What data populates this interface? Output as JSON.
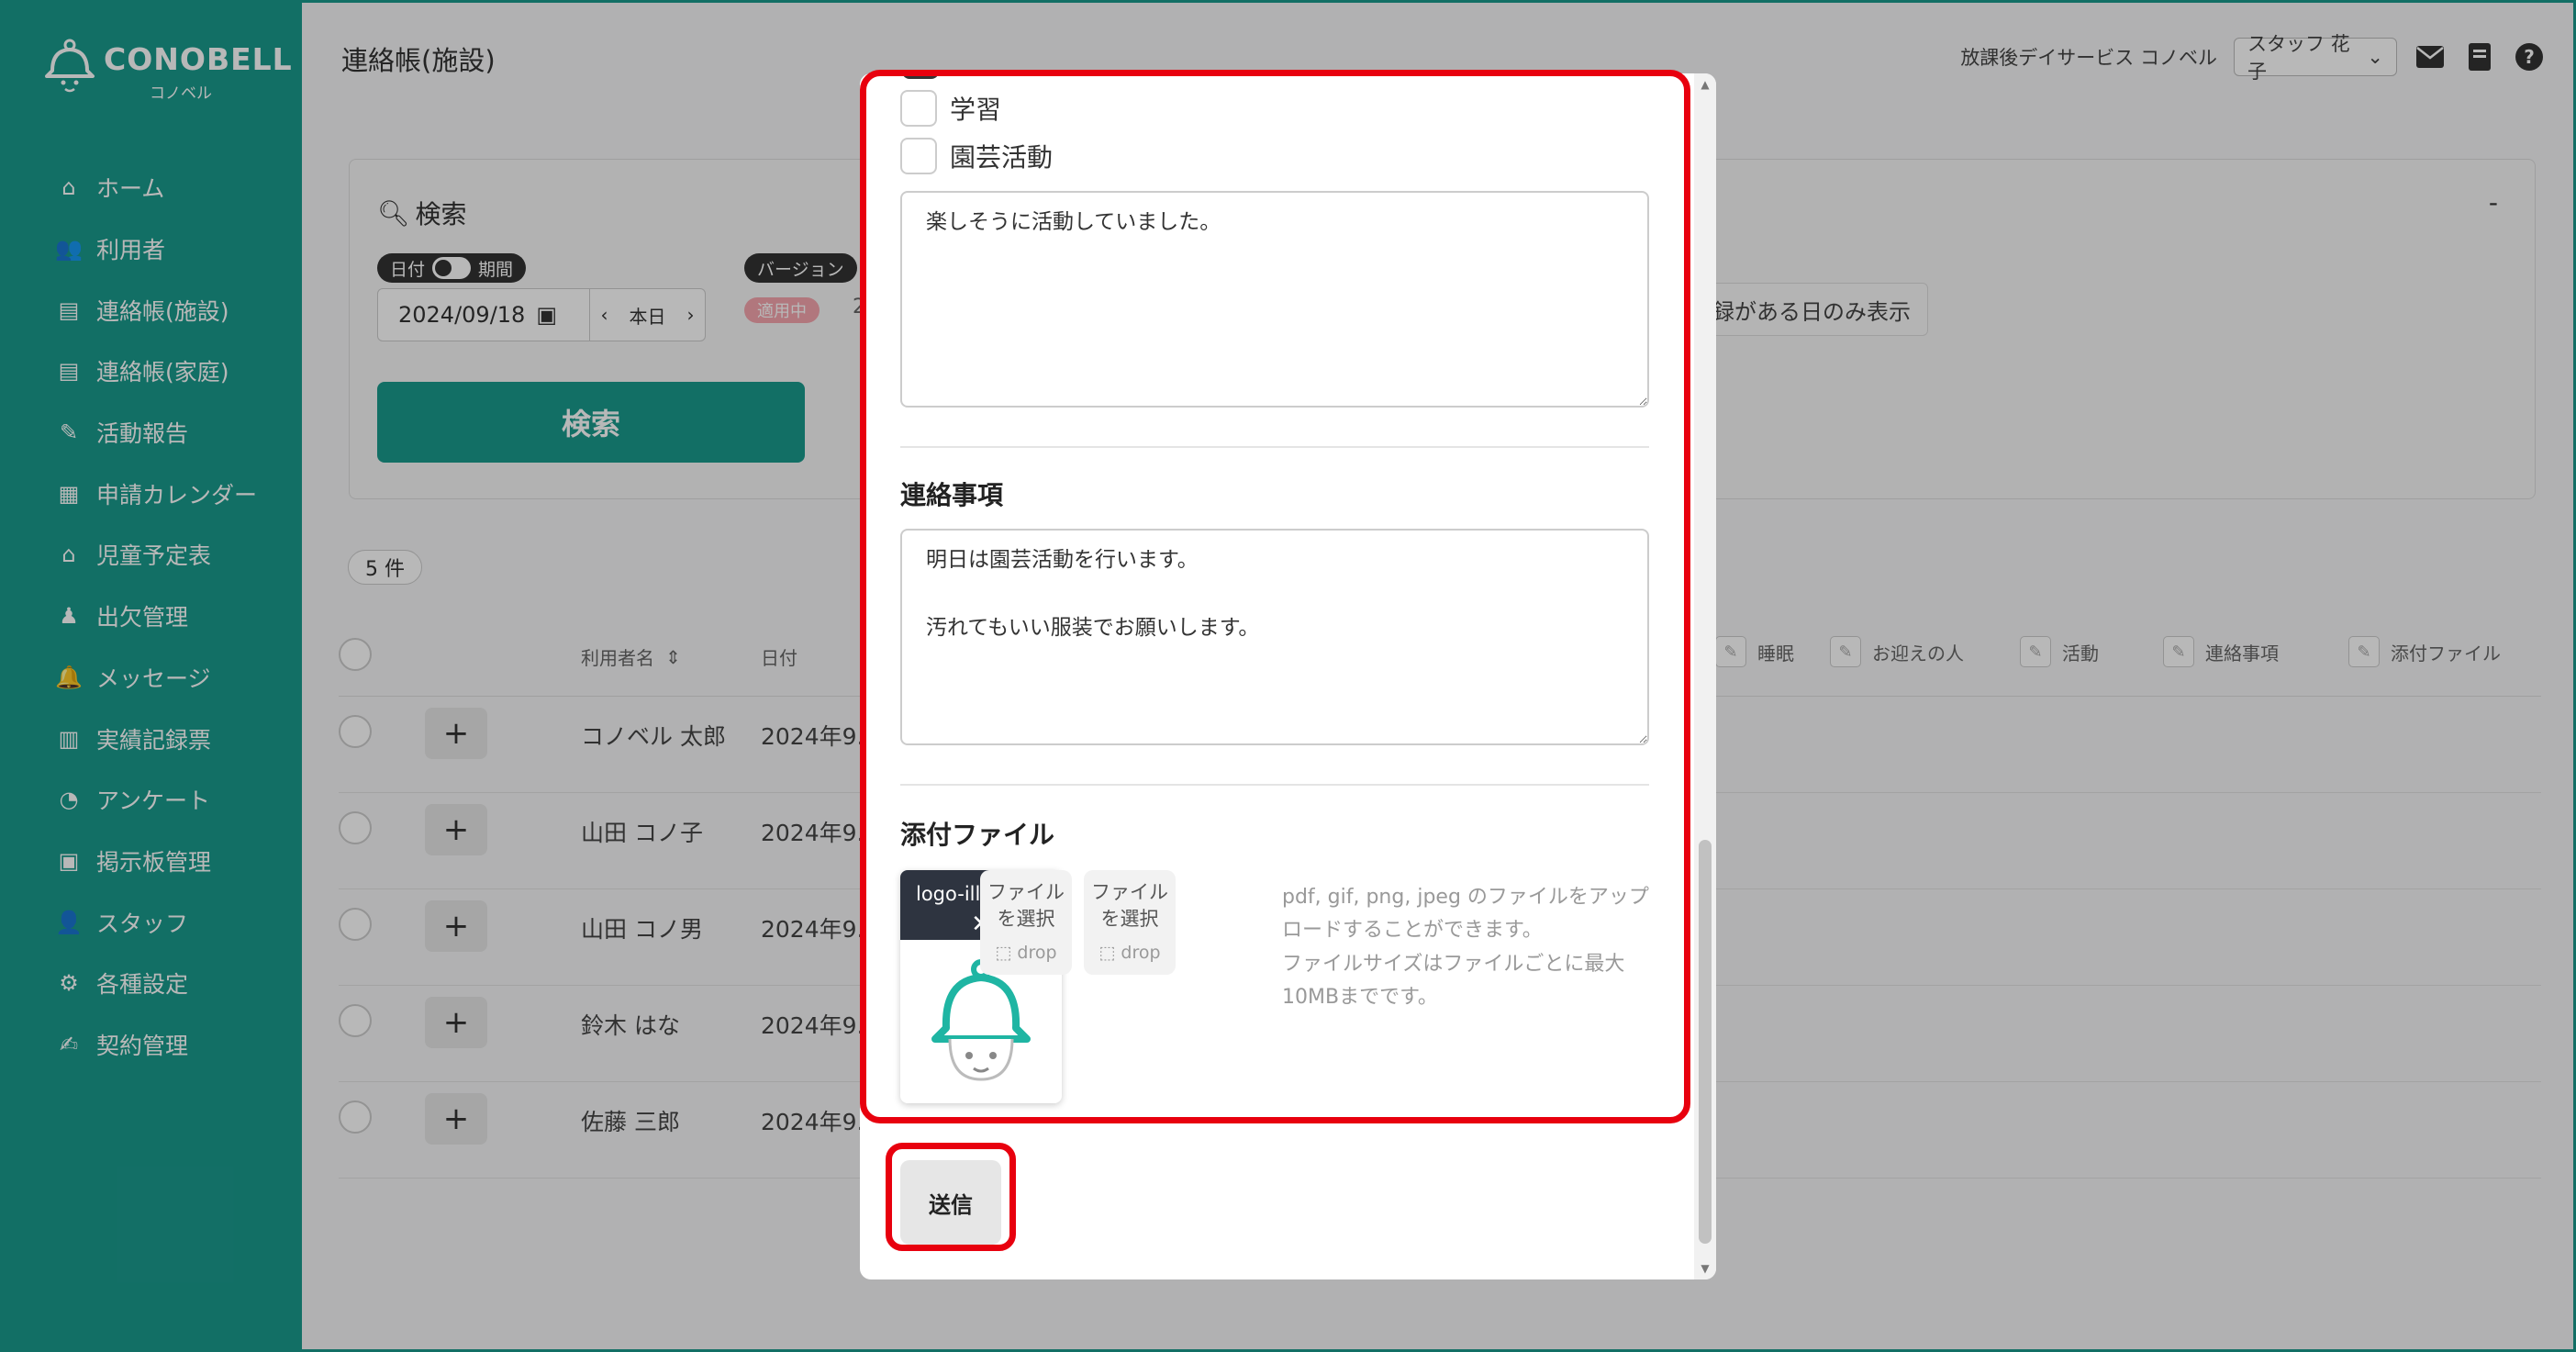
{
  "app": {
    "logo_name": "CONOBELL",
    "logo_kana": "コノベル",
    "page_title": "連絡帳(施設)",
    "facility": "放課後デイサービス コノベル",
    "staff": "スタッフ 花子"
  },
  "sidebar": {
    "items": [
      {
        "label": "ホーム",
        "icon": "home-icon"
      },
      {
        "label": "利用者",
        "icon": "users-icon"
      },
      {
        "label": "連絡帳(施設)",
        "icon": "notebook-icon"
      },
      {
        "label": "連絡帳(家庭)",
        "icon": "notebook-icon"
      },
      {
        "label": "活動報告",
        "icon": "report-edit-icon"
      },
      {
        "label": "申請カレンダー",
        "icon": "calendar-icon"
      },
      {
        "label": "児童予定表",
        "icon": "schedule-icon"
      },
      {
        "label": "出欠管理",
        "icon": "attendance-icon"
      },
      {
        "label": "メッセージ",
        "icon": "bell-icon"
      },
      {
        "label": "実績記録票",
        "icon": "table-icon"
      },
      {
        "label": "アンケート",
        "icon": "pie-chart-icon"
      },
      {
        "label": "掲示板管理",
        "icon": "board-icon"
      },
      {
        "label": "スタッフ",
        "icon": "staff-icon"
      },
      {
        "label": "各種設定",
        "icon": "gear-icon"
      },
      {
        "label": "契約管理",
        "icon": "contract-icon"
      }
    ]
  },
  "search": {
    "title": "検索",
    "collapse": "-",
    "date_pill": "日付",
    "period_pill": "期間",
    "date_value": "2024/09/18",
    "today": "本日",
    "version_pill": "バージョン",
    "applied_badge": "適用中",
    "applied_badge_extra": "2",
    "filter_label": "録がある日のみ表示",
    "button": "検索"
  },
  "list": {
    "count": "5 件",
    "headers": {
      "name": "利用者名",
      "date": "日付"
    },
    "columns": [
      "睡眠",
      "お迎えの人",
      "活動",
      "連絡事項",
      "添付ファイル"
    ],
    "rows": [
      {
        "name": "コノベル 太郎",
        "date": "2024年9."
      },
      {
        "name": "山田 コノ子",
        "date": "2024年9."
      },
      {
        "name": "山田 コノ男",
        "date": "2024年9."
      },
      {
        "name": "鈴木 はな",
        "date": "2024年9."
      },
      {
        "name": "佐藤 三郎",
        "date": "2024年9."
      }
    ]
  },
  "modal": {
    "activities": [
      "学習",
      "園芸活動"
    ],
    "activity_note": "楽しそうに活動していました。",
    "contact_label": "連絡事項",
    "contact_text": "明日は園芸活動を行います。\n\n汚れてもいい服装でお願いします。",
    "attach_label": "添付ファイル",
    "file_name": "logo-illust.jpg",
    "file_remove": "✕",
    "pick_label": "ファイル\nを選択",
    "pick_drop": "drop",
    "note": "pdf, gif, png, jpeg のファイルをアップロードすることができます。\nファイルサイズはファイルごとに最大10MBまでです。",
    "submit": "送信"
  },
  "colors": {
    "brand": "#1a9a8d",
    "highlight": "#e8000e",
    "badge": "#f5a5ad"
  }
}
